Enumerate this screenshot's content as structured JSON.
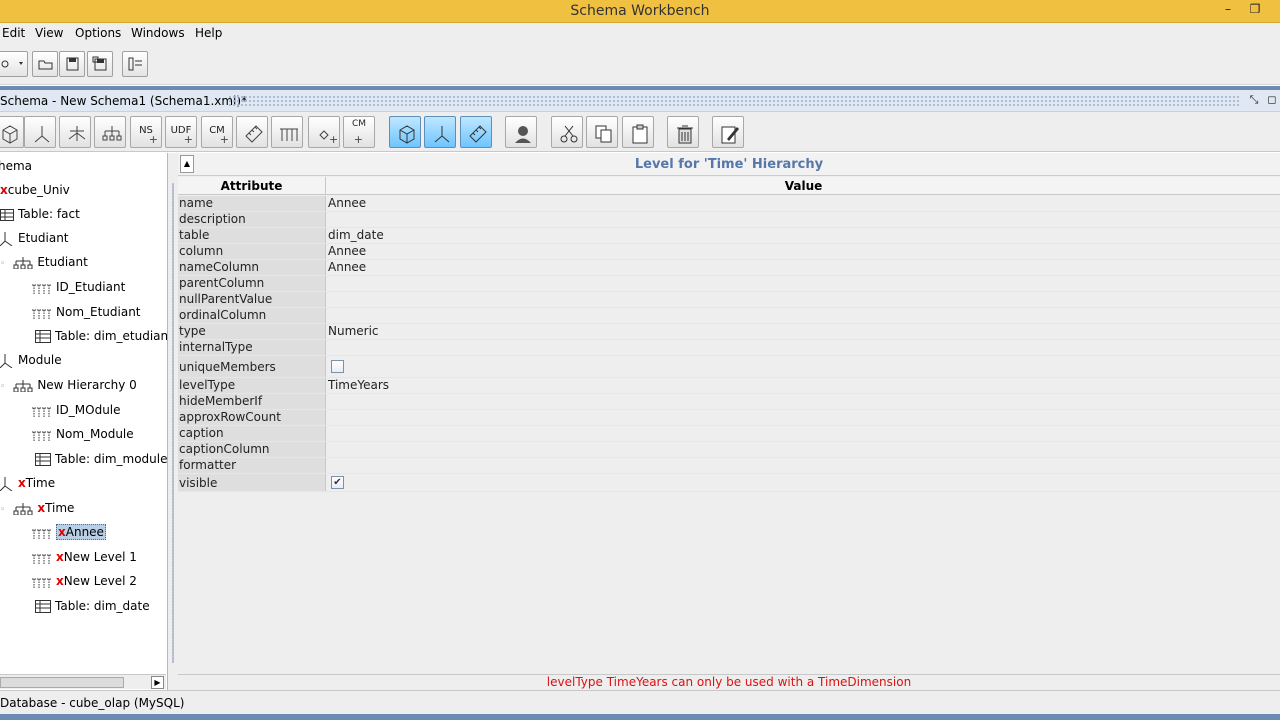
{
  "window": {
    "title": "Schema Workbench",
    "minimize": "–",
    "restore": "❐"
  },
  "menu": [
    "Edit",
    "View",
    "Options",
    "Windows",
    "Help"
  ],
  "frame": {
    "title": "Schema - New Schema1 (Schema1.xml)*"
  },
  "schema_toolbar": {
    "labels": {
      "ns": "NS",
      "udf": "UDF",
      "cm": "CM",
      "cm2": "CM"
    }
  },
  "tree": {
    "nodes": [
      {
        "label": "hema",
        "error": ""
      },
      {
        "label": "cube_Univ",
        "error": "x"
      },
      {
        "label": "Table: fact",
        "error": ""
      },
      {
        "label": "Etudiant",
        "error": ""
      },
      {
        "label": "Etudiant",
        "error": ""
      },
      {
        "label": "ID_Etudiant",
        "error": ""
      },
      {
        "label": "Nom_Etudiant",
        "error": ""
      },
      {
        "label": "Table: dim_etudiant",
        "error": ""
      },
      {
        "label": "Module",
        "error": ""
      },
      {
        "label": "New Hierarchy 0",
        "error": ""
      },
      {
        "label": "ID_MOdule",
        "error": ""
      },
      {
        "label": "Nom_Module",
        "error": ""
      },
      {
        "label": "Table: dim_module",
        "error": ""
      },
      {
        "label": "Time",
        "error": "x"
      },
      {
        "label": "Time",
        "error": "x"
      },
      {
        "label": "Annee",
        "error": "x"
      },
      {
        "label": "New Level 1",
        "error": "x"
      },
      {
        "label": "New Level 2",
        "error": "x"
      },
      {
        "label": "Table: dim_date",
        "error": ""
      }
    ]
  },
  "properties": {
    "heading": "Level for 'Time' Hierarchy",
    "col_attribute": "Attribute",
    "col_value": "Value",
    "rows": [
      {
        "key": "name",
        "value": "Annee"
      },
      {
        "key": "description",
        "value": ""
      },
      {
        "key": "table",
        "value": "dim_date"
      },
      {
        "key": "column",
        "value": "Annee"
      },
      {
        "key": "nameColumn",
        "value": "Annee"
      },
      {
        "key": "parentColumn",
        "value": ""
      },
      {
        "key": "nullParentValue",
        "value": ""
      },
      {
        "key": "ordinalColumn",
        "value": ""
      },
      {
        "key": "type",
        "value": "Numeric"
      },
      {
        "key": "internalType",
        "value": ""
      },
      {
        "key": "uniqueMembers",
        "value": ""
      },
      {
        "key": "levelType",
        "value": "TimeYears"
      },
      {
        "key": "hideMemberIf",
        "value": ""
      },
      {
        "key": "approxRowCount",
        "value": ""
      },
      {
        "key": "caption",
        "value": ""
      },
      {
        "key": "captionColumn",
        "value": ""
      },
      {
        "key": "formatter",
        "value": ""
      },
      {
        "key": "visible",
        "value": ""
      }
    ],
    "checkbox_checked_glyph": "✔",
    "unique_members_checked": false,
    "visible_checked": true
  },
  "error_message": "levelType TimeYears can only be used with a TimeDimension",
  "status": "Database - cube_olap (MySQL)"
}
